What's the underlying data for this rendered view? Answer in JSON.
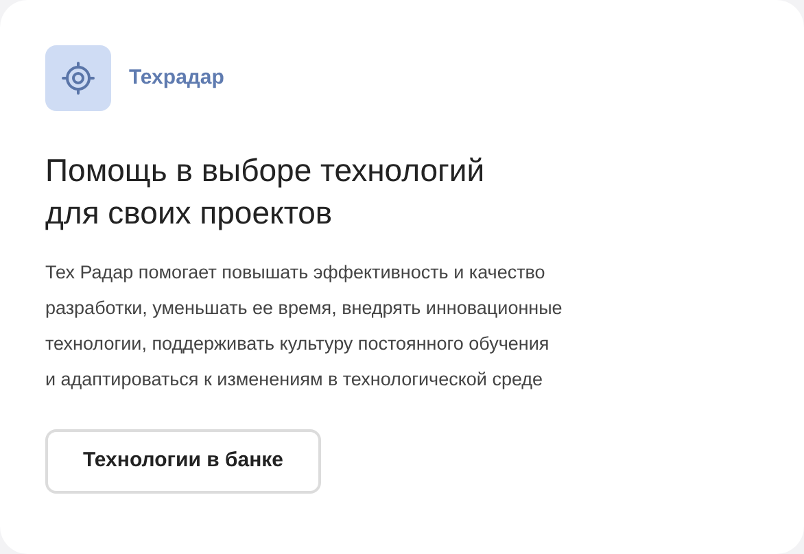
{
  "card": {
    "label": "Техрадар",
    "title_lines": [
      "Помощь в выборе технологий",
      "для своих проектов"
    ],
    "description_lines": [
      "Тех Радар помогает повышать эффективность и качество",
      "разработки, уменьшать ее время, внедрять инновационные",
      "технологии, поддерживать культуру постоянного обучения",
      "и адаптироваться к изменениям в технологической среде"
    ],
    "button": "Технологии в банке"
  }
}
